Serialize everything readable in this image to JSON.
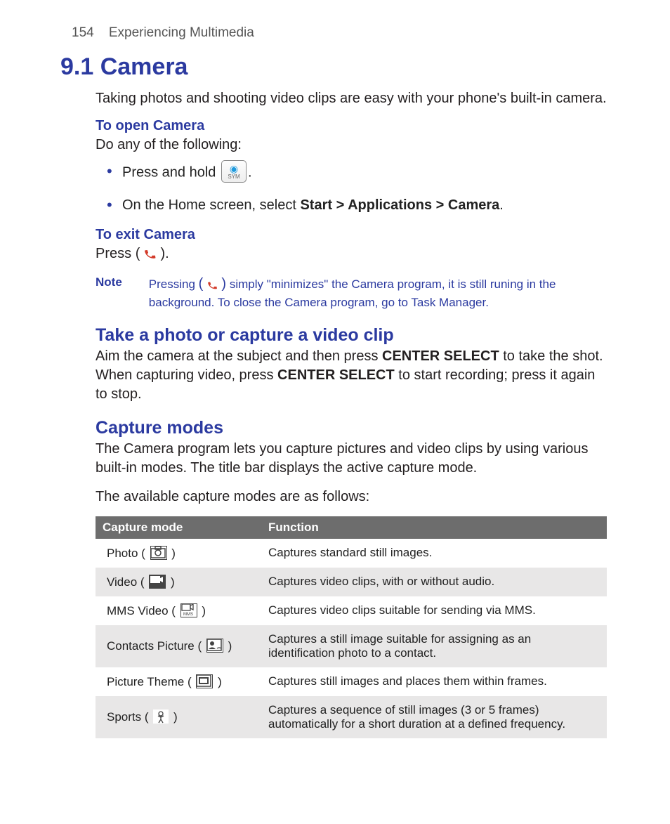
{
  "header": {
    "page_number": "154",
    "chapter": "Experiencing Multimedia"
  },
  "section": {
    "heading": "9.1  Camera",
    "intro": "Taking photos and shooting video clips are easy with your phone's built-in camera.",
    "open_title": "To open Camera",
    "open_lead": "Do any of the following:",
    "bullet1_pre": "Press and hold ",
    "bullet1_post": ".",
    "bullet2_pre": "On the Home screen, select ",
    "bullet2_bold": "Start > Applications > Camera",
    "bullet2_post": ".",
    "exit_title": "To exit Camera",
    "exit_line_pre": "Press ",
    "exit_line_post": ".",
    "note_label": "Note",
    "note_pre": "Pressing ",
    "note_post": " simply \"minimizes\" the Camera program, it is still runing in the background. To close the Camera program, go to Task Manager.",
    "take_heading": "Take a photo or capture a video clip",
    "take_p1a": "Aim the camera at the subject and then press ",
    "take_p1b": "CENTER SELECT",
    "take_p1c": " to take the shot. When capturing video, press ",
    "take_p1d": "CENTER SELECT",
    "take_p1e": " to start recording; press it again to stop.",
    "modes_heading": "Capture modes",
    "modes_p1": "The Camera program lets you capture pictures and video clips by using various built-in modes. The title bar displays the active capture mode.",
    "modes_p2": "The available capture modes are as follows:"
  },
  "table": {
    "col1": "Capture mode",
    "col2": "Function",
    "rows": [
      {
        "mode": "Photo",
        "func": "Captures standard still images."
      },
      {
        "mode": "Video",
        "func": "Captures video clips, with or without audio."
      },
      {
        "mode": "MMS Video",
        "func": "Captures video clips suitable for sending via MMS."
      },
      {
        "mode": "Contacts Picture",
        "func": "Captures a still image suitable for assigning as an identification photo to a contact."
      },
      {
        "mode": "Picture Theme",
        "func": "Captures still images and places them within frames."
      },
      {
        "mode": "Sports",
        "func": "Captures a sequence of still images (3 or 5 frames) automatically for a short duration at a defined frequency."
      }
    ]
  },
  "icons": {
    "sym_label": "SYM"
  }
}
